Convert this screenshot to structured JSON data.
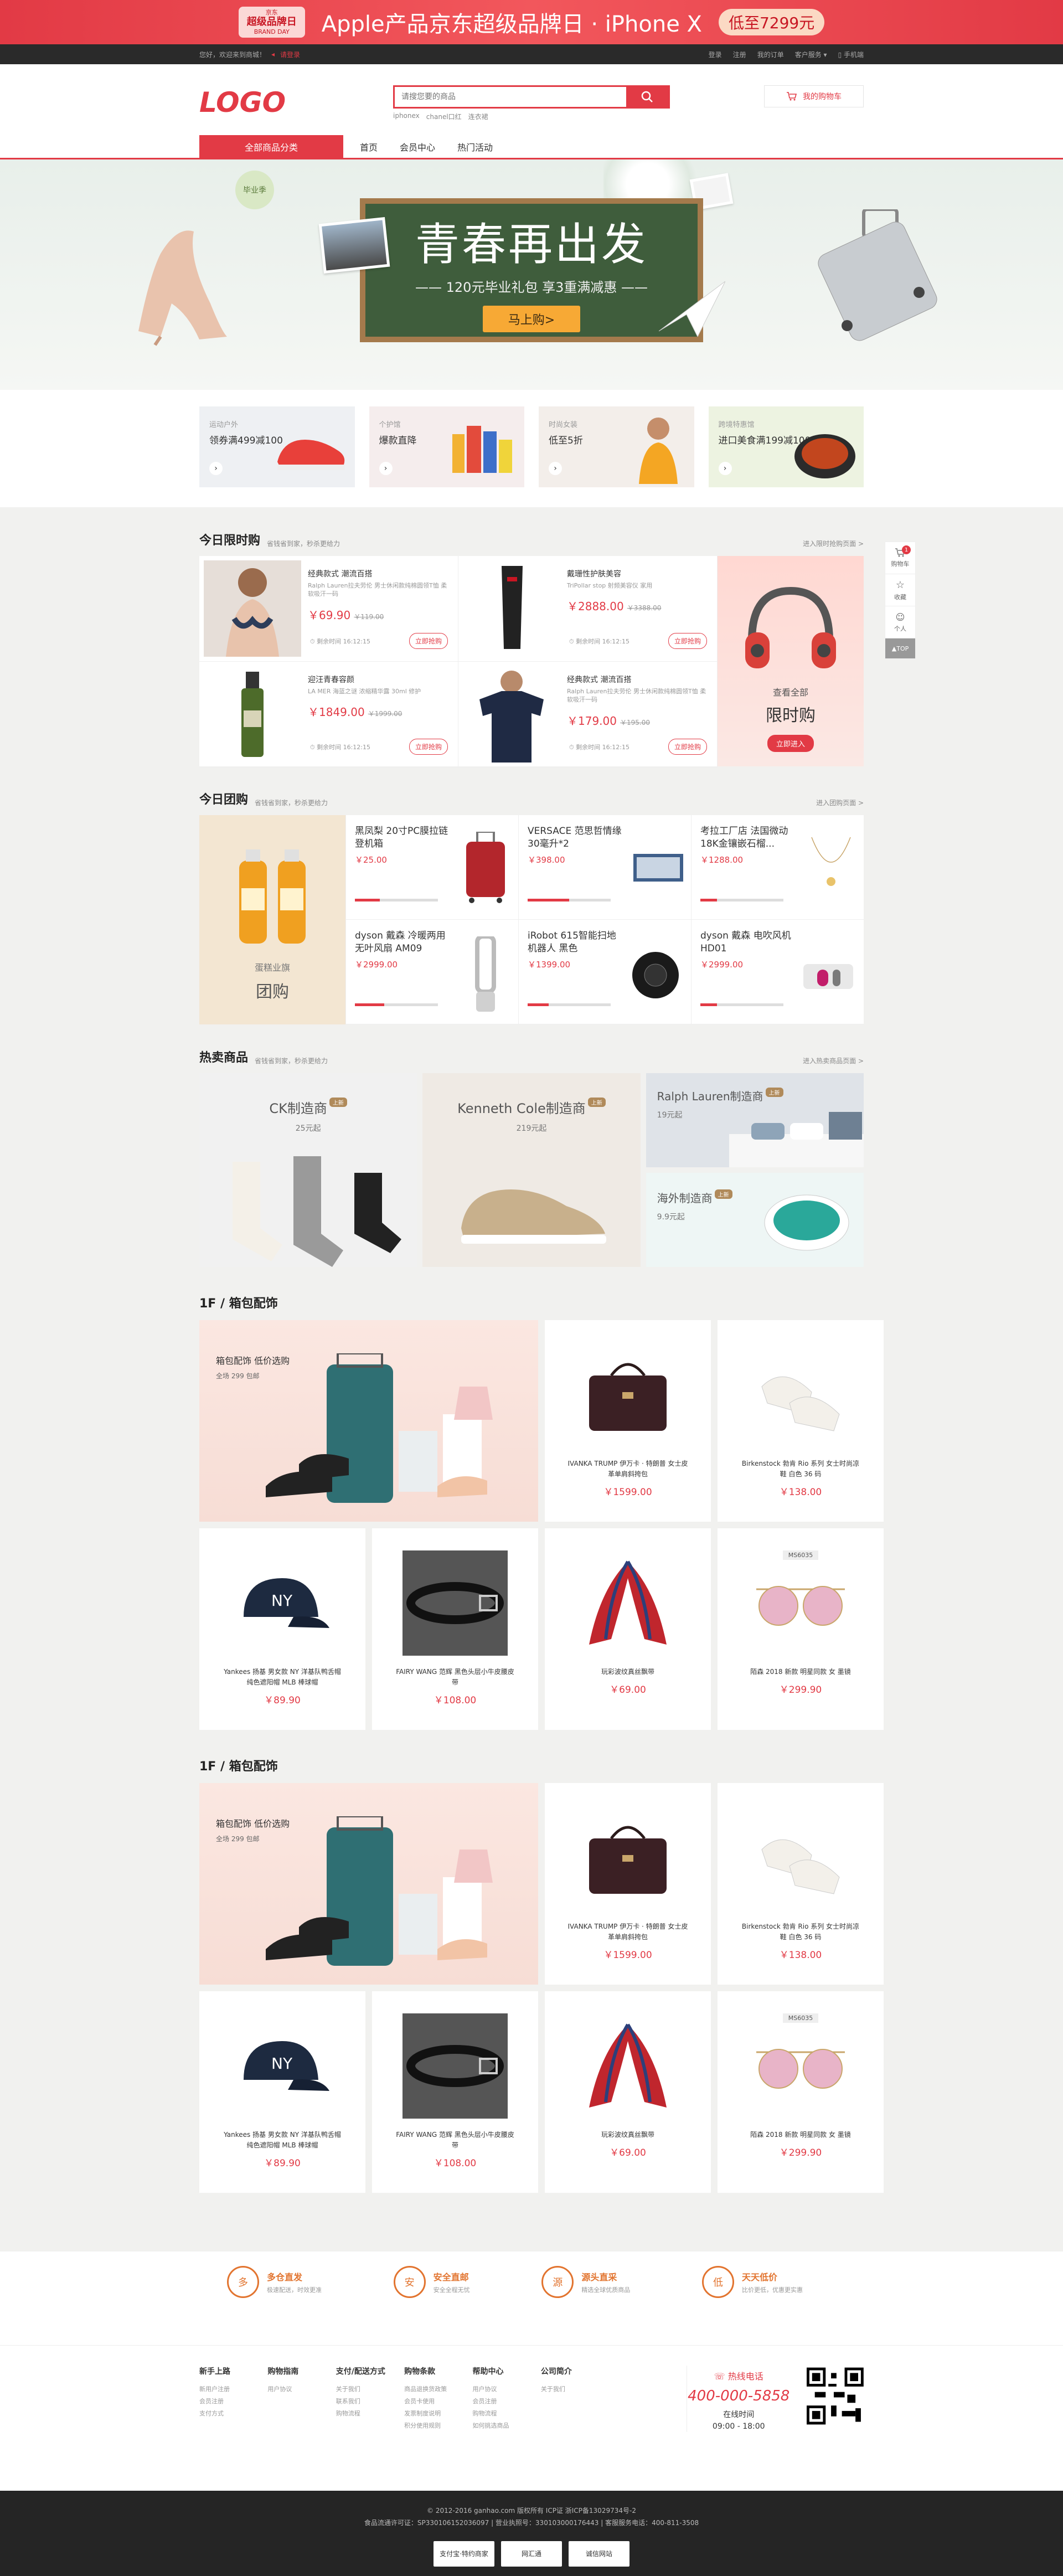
{
  "topad": {
    "badge_line1": "京东",
    "badge_line2": "超级品牌日",
    "badge_line3": "BRAND DAY",
    "title": "Apple产品京东超级品牌日 · iPhone X",
    "price": "低至7299元"
  },
  "topbar": {
    "welcome": "您好，欢迎来到商城！",
    "location": "请登录",
    "links": [
      "登录",
      "注册",
      "我的订单",
      "客户服务",
      "手机端"
    ]
  },
  "header": {
    "logo": "LOGO",
    "search_placeholder": "请搜您要的商品",
    "hotwords": [
      "iphonex",
      "chanel口红",
      "连衣裙"
    ],
    "cart_label": "我的购物车"
  },
  "nav": {
    "category": "全部商品分类",
    "items": [
      "首页",
      "会员中心",
      "热门活动"
    ]
  },
  "banner": {
    "title": "青春再出发",
    "subtitle": "—— 120元毕业礼包 享3重满减惠 ——",
    "button": "马上购>",
    "badge": "毕业季"
  },
  "promos": [
    {
      "t1": "运动户外",
      "t2": "领券满499减100",
      "color": "#eef0f3"
    },
    {
      "t1": "个护馆",
      "t2": "爆款直降",
      "color": "#f5eded"
    },
    {
      "t1": "时尚女装",
      "t2": "低至5折",
      "color": "#f3eeea"
    },
    {
      "t1": "跨境特惠馆",
      "t2": "进口美食满199减100",
      "color": "#edf3e1"
    }
  ],
  "limited": {
    "title": "今日限时购",
    "tip": "省钱省到家，秒杀更给力",
    "more": "进入限时抢购页面 >",
    "items": [
      {
        "name": "经典款式 潮流百搭",
        "desc": "Ralph Lauren拉夫劳伦 男士休闲款纯棉圆领T恤 柔软吸汗一码",
        "price": "￥69.90",
        "old": "￥119.00",
        "cd": "剩余时间 16:12:15",
        "buy": "立即抢购"
      },
      {
        "name": "戴珊性护肤美容",
        "desc": "TriPollar stop 射频美容仪 家用",
        "price": "￥2888.00",
        "old": "￥3388.00",
        "cd": "剩余时间 16:12:15",
        "buy": "立即抢购"
      },
      {
        "name": "迎汪青春容颜",
        "desc": "LA MER 海蓝之谜 浓缩精华露 30ml 修护",
        "price": "￥1849.00",
        "old": "￥1999.00",
        "cd": "剩余时间 16:12:15",
        "buy": "立即抢购"
      },
      {
        "name": "经典款式 潮流百搭",
        "desc": "Ralph Lauren拉夫劳伦 男士休闲款纯棉圆领T恤 柔软吸汗一码",
        "price": "￥179.00",
        "old": "￥195.00",
        "cd": "剩余时间 16:12:15",
        "buy": "立即抢购"
      }
    ],
    "all_t1": "查看全部",
    "all_t2": "限时购",
    "all_btn": "立即进入"
  },
  "group": {
    "title": "今日团购",
    "tip": "省钱省到家，秒杀更给力",
    "more": "进入团购页面 >",
    "left_t1": "蛋糕业旗",
    "left_t2": "团购",
    "items": [
      {
        "name": "黑凤梨 20寸PC膜拉链登机箱",
        "price": "￥25.00",
        "progress": 0.3
      },
      {
        "name": "VERSACE 范思哲情缘30毫升*2",
        "price": "￥398.00",
        "progress": 0.5
      },
      {
        "name": "考拉工厂店 法国微动18K金镶嵌石榴...",
        "price": "￥1288.00",
        "progress": 0.2
      },
      {
        "name": "dyson 戴森 冷暖两用无叶风扇 AM09",
        "price": "￥2999.00",
        "progress": 0.35
      },
      {
        "name": "iRobot 615智能扫地机器人 黑色",
        "price": "￥1399.00",
        "progress": 0.25
      },
      {
        "name": "dyson 戴森 电吹风机HD01",
        "price": "￥2999.00",
        "progress": 0.2
      }
    ]
  },
  "hot": {
    "title": "热卖商品",
    "tip": "省钱省到家，秒杀更给力",
    "more": "进入热卖商品页面 >",
    "cards": [
      {
        "t1": "CK制造商",
        "t2": "25元起",
        "tag": "上新"
      },
      {
        "t1": "Kenneth Cole制造商",
        "t2": "219元起",
        "tag": "上新"
      },
      {
        "t1": "Ralph Lauren制造商",
        "t2": "19元起",
        "tag": "上新"
      },
      {
        "t1": "海外制造商",
        "t2": "9.9元起",
        "tag": "上新"
      }
    ]
  },
  "floors": [
    {
      "title": "1F / 箱包配饰",
      "big_t1": "箱包配饰 低价选购",
      "big_t2": "全场 299 包邮",
      "items": [
        {
          "name": "IVANKA TRUMP 伊万卡 · 特朗普 女士皮革单肩斜挎包",
          "price": "￥1599.00",
          "code": ""
        },
        {
          "name": "Birkenstock 勃肯 Rio 系列 女士时尚凉鞋 白色 36 码",
          "price": "￥138.00",
          "code": ""
        },
        {
          "name": "Yankees 扬基 男女款 NY 洋基队鸭舌帽 纯色遮阳帽 MLB 棒球帽",
          "price": "￥89.90",
          "code": ""
        },
        {
          "name": "FAIRY WANG 范辉 黑色头层小牛皮腰皮带",
          "price": "￥108.00",
          "code": ""
        },
        {
          "name": "玩彩波纹真丝飘带",
          "price": "￥69.00",
          "code": ""
        },
        {
          "name": "陌森 2018 新款 明星同款 女 墨镜",
          "price": "￥299.90",
          "code": "MS6035"
        }
      ]
    },
    {
      "title": "1F / 箱包配饰",
      "big_t1": "箱包配饰 低价选购",
      "big_t2": "全场 299 包邮",
      "items": [
        {
          "name": "IVANKA TRUMP 伊万卡 · 特朗普 女士皮革单肩斜挎包",
          "price": "￥1599.00",
          "code": ""
        },
        {
          "name": "Birkenstock 勃肯 Rio 系列 女士时尚凉鞋 白色 36 码",
          "price": "￥138.00",
          "code": ""
        },
        {
          "name": "Yankees 扬基 男女款 NY 洋基队鸭舌帽 纯色遮阳帽 MLB 棒球帽",
          "price": "￥89.90",
          "code": ""
        },
        {
          "name": "FAIRY WANG 范辉 黑色头层小牛皮腰皮带",
          "price": "￥108.00",
          "code": ""
        },
        {
          "name": "玩彩波纹真丝飘带",
          "price": "￥69.00",
          "code": ""
        },
        {
          "name": "陌森 2018 新款 明星同款 女 墨镜",
          "price": "￥299.90",
          "code": "MS6035"
        }
      ]
    }
  ],
  "service": [
    {
      "icon": "多",
      "t1": "多仓直发",
      "t2": "极速配送，时效更准"
    },
    {
      "icon": "安",
      "t1": "安全直邮",
      "t2": "安全全程无忧"
    },
    {
      "icon": "源",
      "t1": "源头直采",
      "t2": "精选全球优质商品"
    },
    {
      "icon": "低",
      "t1": "天天低价",
      "t2": "比价更低，优惠更实惠"
    }
  ],
  "links": [
    {
      "title": "新手上路",
      "items": [
        "新用户注册",
        "会员注册",
        "支付方式"
      ]
    },
    {
      "title": "购物指南",
      "items": [
        "用户协议"
      ]
    },
    {
      "title": "支付/配送方式",
      "items": [
        "关于我们",
        "联系我们",
        "购物流程"
      ]
    },
    {
      "title": "购物条款",
      "items": [
        "商品退换货政策",
        "会员卡使用",
        "发票制度说明",
        "积分使用规则"
      ]
    },
    {
      "title": "帮助中心",
      "items": [
        "用户协议",
        "会员注册",
        "购物流程",
        "如何挑选商品"
      ]
    },
    {
      "title": "公司简介",
      "items": [
        "关于我们"
      ]
    }
  ],
  "hotline": {
    "t1": "热线电话",
    "t2": "400-000-5858",
    "t3": "在线时间",
    "t4": "09:00 - 18:00"
  },
  "copyright": {
    "line1": "© 2012-2016 ganhao.com 版权所有 ICP证 浙ICP备13029734号-2",
    "line2": "食品流通许可证：SP330106152036097 | 营业执照号：330103000176443 | 客服服务电话：400-811-3508",
    "badges": [
      "支付宝·特约商家",
      "网汇通",
      "诚信网站"
    ]
  },
  "sidebar": {
    "items": [
      "购物车",
      "收藏",
      "个人"
    ],
    "cart_count": "1",
    "top": "TOP"
  }
}
